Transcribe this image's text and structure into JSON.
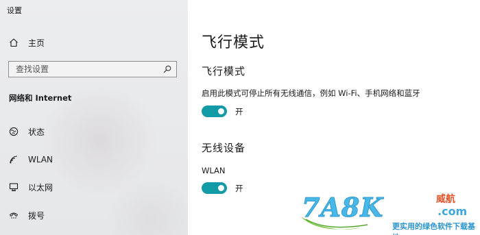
{
  "app": {
    "title": "设置"
  },
  "sidebar": {
    "home_label": "主页",
    "search": {
      "placeholder": "查找设置",
      "value": ""
    },
    "section_title": "网络和 Internet",
    "items": [
      {
        "label": "状态",
        "icon": "globe-status-icon"
      },
      {
        "label": "WLAN",
        "icon": "wifi-icon"
      },
      {
        "label": "以太网",
        "icon": "ethernet-icon"
      },
      {
        "label": "拨号",
        "icon": "dialup-icon"
      }
    ]
  },
  "main": {
    "page_title": "飞行模式",
    "airplane": {
      "heading": "飞行模式",
      "description": "启用此模式可停止所有无线通信，例如 Wi-Fi、手机网络和蓝牙",
      "toggle_state": "开",
      "on": true
    },
    "wireless": {
      "heading": "无线设备",
      "devices": [
        {
          "name": "WLAN",
          "toggle_state": "开",
          "on": true
        }
      ]
    }
  },
  "watermark": {
    "logo": "7A8K",
    "tag": "威航",
    "domain": ".com",
    "slogan": "更实用的绿色软件下载基地"
  },
  "colors": {
    "accent": "#139aa7",
    "sidebar_bg": "#e9eaec",
    "watermark_blue": "#4ab8e6",
    "watermark_red": "#e4552c"
  }
}
